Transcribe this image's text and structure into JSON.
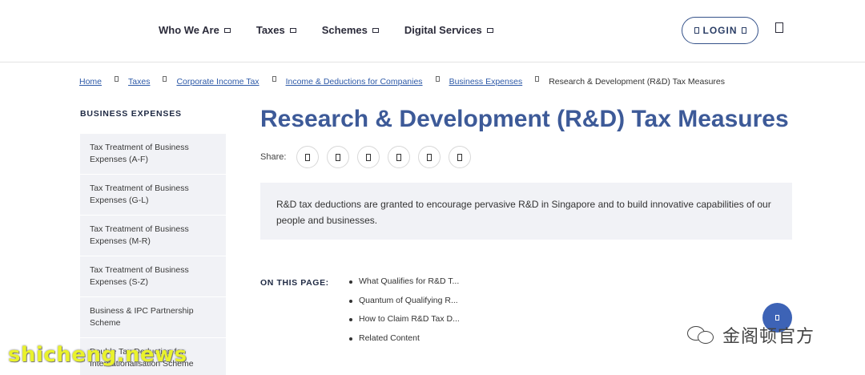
{
  "nav": {
    "items": [
      {
        "label": "Who We Are"
      },
      {
        "label": "Taxes"
      },
      {
        "label": "Schemes"
      },
      {
        "label": "Digital Services"
      }
    ],
    "login_label": "LOGIN"
  },
  "breadcrumb": {
    "links": [
      {
        "label": "Home"
      },
      {
        "label": "Taxes"
      },
      {
        "label": "Corporate Income Tax"
      },
      {
        "label": "Income & Deductions for Companies"
      },
      {
        "label": "Business Expenses"
      }
    ],
    "current": "Research & Development (R&D) Tax Measures"
  },
  "sidebar": {
    "title": "BUSINESS EXPENSES",
    "items": [
      {
        "label": "Tax Treatment of Business Expenses (A-F)"
      },
      {
        "label": "Tax Treatment of Business Expenses (G-L)"
      },
      {
        "label": "Tax Treatment of Business Expenses (M-R)"
      },
      {
        "label": "Tax Treatment of Business Expenses (S-Z)"
      },
      {
        "label": "Business & IPC Partnership Scheme"
      },
      {
        "label": "Double Tax Deduction for Internationalisation Scheme"
      }
    ]
  },
  "main": {
    "title": "Research & Development (R&D) Tax Measures",
    "share_label": "Share:",
    "share_icons": [
      "facebook-icon",
      "twitter-icon",
      "linkedin-icon",
      "whatsapp-icon",
      "email-icon",
      "print-icon"
    ],
    "intro": "R&D tax deductions are granted to encourage pervasive R&D in Singapore and to build innovative capabilities of our people and businesses.",
    "on_this_page_label": "ON THIS PAGE:",
    "on_this_page": [
      {
        "label": "What Qualifies for R&D T..."
      },
      {
        "label": "Quantum of Qualifying R..."
      },
      {
        "label": "How to Claim R&D Tax D..."
      },
      {
        "label": "Related Content"
      }
    ]
  },
  "watermarks": {
    "left": "shicheng.news",
    "right": "金阁顿官方"
  },
  "colors": {
    "accent": "#3d5a98",
    "link": "#2e5aa8",
    "panel": "#f1f2f6",
    "fab": "#3d63b6"
  }
}
